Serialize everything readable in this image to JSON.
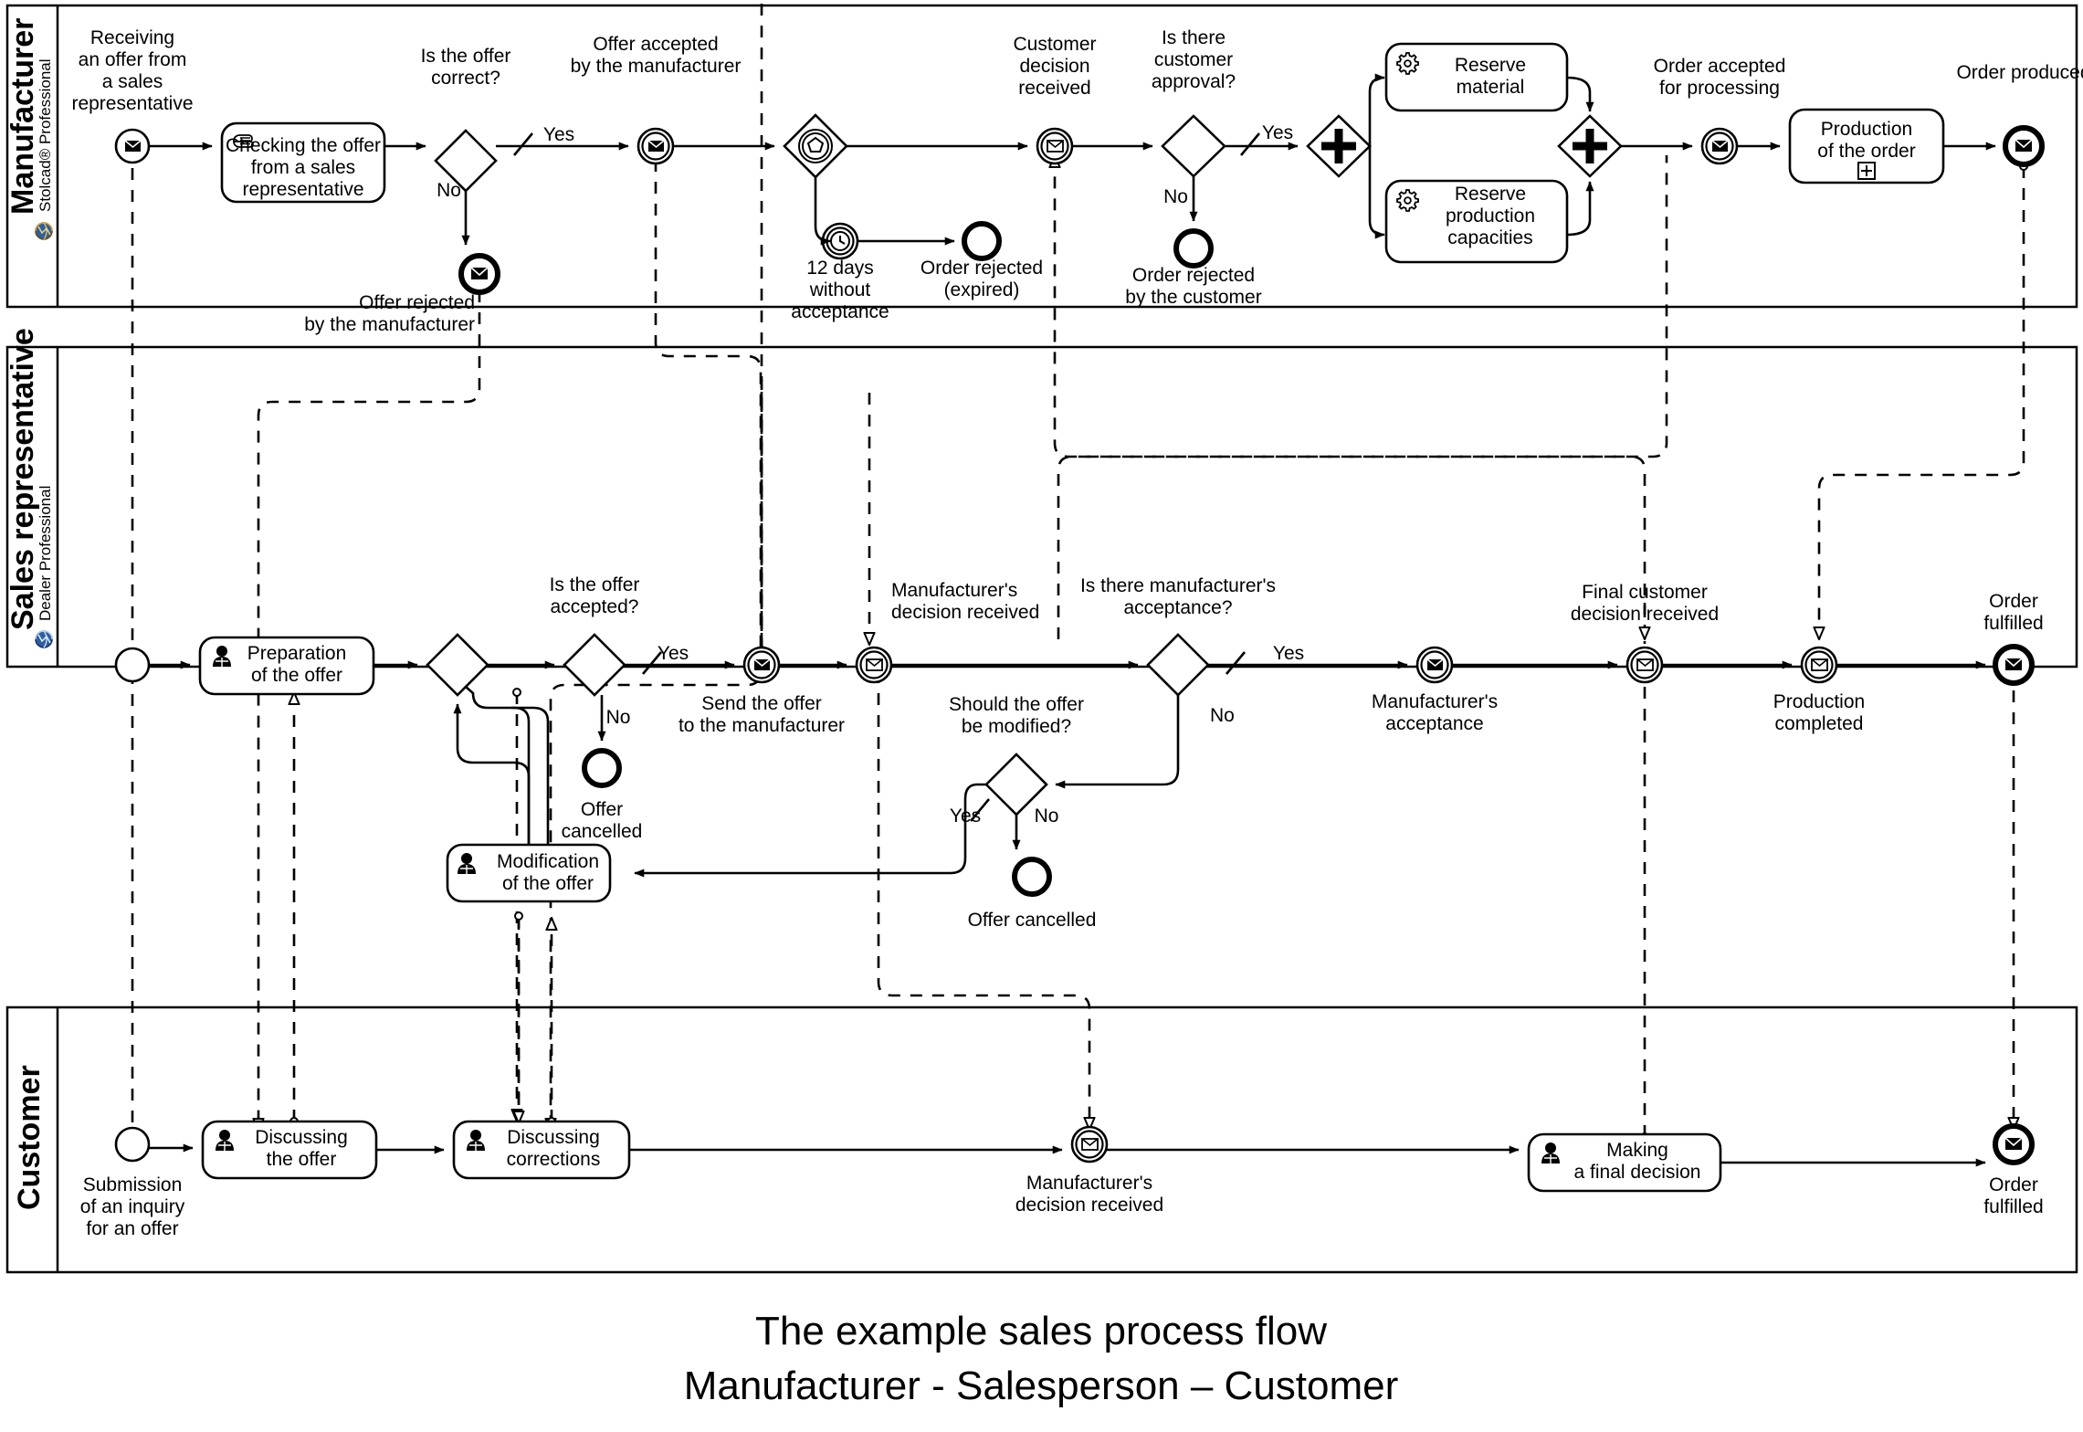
{
  "caption": {
    "line1": "The example sales process flow",
    "line2": "Manufacturer - Salesperson – Customer"
  },
  "lanes": [
    {
      "id": "manufacturer",
      "title": "Manufacturer",
      "subtitle": "Stolcad® Professional",
      "icon": "globe-icon"
    },
    {
      "id": "sales_representative",
      "title": "Sales representative",
      "subtitle": "Dealer Professional",
      "icon": "globe-icon"
    },
    {
      "id": "customer",
      "title": "Customer",
      "subtitle": "",
      "icon": ""
    }
  ],
  "manufacturer_lane": {
    "start_event": {
      "label": "Receiving\nan offer from\na sales\nrepresentative",
      "type": "message-start-event"
    },
    "tasks": [
      {
        "id": "checking_offer",
        "label": "Checking the offer\nfrom a sales\nrepresentative",
        "marker": "manual-task-icon"
      },
      {
        "id": "reserve_material",
        "label": "Reserve\nmaterial",
        "marker": "service-task-icon"
      },
      {
        "id": "reserve_capacities",
        "label": "Reserve\nproduction\ncapacities",
        "marker": "service-task-icon"
      },
      {
        "id": "production_order",
        "label": "Production\nof the order",
        "marker": "subprocess-plus-icon"
      }
    ],
    "gateways": [
      {
        "id": "is_offer_correct",
        "label": "Is the offer\ncorrect?",
        "type": "exclusive-gateway",
        "yes": "Yes",
        "no": "No"
      },
      {
        "id": "event_based",
        "label": "",
        "type": "event-based-gateway"
      },
      {
        "id": "is_customer_approval",
        "label": "Is there\ncustomer\napproval?",
        "type": "exclusive-gateway",
        "yes": "Yes",
        "no": "No"
      },
      {
        "id": "parallel_split",
        "label": "",
        "type": "parallel-gateway"
      },
      {
        "id": "parallel_join",
        "label": "",
        "type": "parallel-gateway"
      }
    ],
    "events": [
      {
        "id": "offer_rejected_manufacturer",
        "label": "Offer rejected\nby the manufacturer",
        "type": "message-end-event"
      },
      {
        "id": "offer_accepted_manufacturer",
        "label": "Offer accepted\nby the manufacturer",
        "type": "message-intermediate-throw-event"
      },
      {
        "id": "twelve_days",
        "label": "12 days\nwithout\nacceptance",
        "type": "timer-intermediate-event"
      },
      {
        "id": "order_rejected_expired",
        "label": "Order rejected\n(expired)",
        "type": "end-event"
      },
      {
        "id": "customer_decision_received",
        "label": "Customer\ndecision\nreceived",
        "type": "message-intermediate-catch-event"
      },
      {
        "id": "order_rejected_customer",
        "label": "Order rejected\nby the customer",
        "type": "end-event"
      },
      {
        "id": "order_accepted_processing",
        "label": "Order accepted\nfor processing",
        "type": "message-intermediate-throw-event"
      },
      {
        "id": "order_produced",
        "label": "Order produced",
        "type": "message-end-event"
      }
    ]
  },
  "sales_lane": {
    "start_event": {
      "label": "",
      "type": "start-event"
    },
    "tasks": [
      {
        "id": "preparation_offer",
        "label": "Preparation\nof the offer",
        "marker": "user-task-icon"
      },
      {
        "id": "modification_offer",
        "label": "Modification\nof the offer",
        "marker": "user-task-icon"
      }
    ],
    "gateways": [
      {
        "id": "merge_gateway",
        "label": "",
        "type": "exclusive-gateway"
      },
      {
        "id": "is_offer_accepted",
        "label": "Is the offer\naccepted?",
        "type": "exclusive-gateway",
        "yes": "Yes",
        "no": "No"
      },
      {
        "id": "is_manufacturer_acceptance",
        "label": "Is there manufacturer's\nacceptance?",
        "type": "exclusive-gateway",
        "yes": "Yes",
        "no": "No"
      },
      {
        "id": "should_offer_be_modified",
        "label": "Should the offer\nbe modified?",
        "type": "exclusive-gateway",
        "yes": "Yes",
        "no": "No"
      }
    ],
    "events": [
      {
        "id": "offer_cancelled_1",
        "label": "Offer\ncancelled",
        "type": "end-event"
      },
      {
        "id": "send_offer_to_manufacturer",
        "label": "Send the offer\nto the manufacturer",
        "type": "message-intermediate-throw-event"
      },
      {
        "id": "manufacturers_decision_received",
        "label": "Manufacturer's\ndecision received",
        "type": "message-intermediate-catch-event"
      },
      {
        "id": "offer_cancelled_2",
        "label": "Offer cancelled",
        "type": "end-event"
      },
      {
        "id": "manufacturers_acceptance",
        "label": "Manufacturer's\nacceptance",
        "type": "message-intermediate-throw-event"
      },
      {
        "id": "final_customer_decision_received",
        "label": "Final customer\ndecision received",
        "type": "message-intermediate-catch-event"
      },
      {
        "id": "production_completed",
        "label": "Production\ncompleted",
        "type": "message-intermediate-catch-event"
      },
      {
        "id": "order_fulfilled_sales",
        "label": "Order\nfulfilled",
        "type": "message-end-event"
      }
    ]
  },
  "customer_lane": {
    "start_event": {
      "label": "Submission\nof an inquiry\nfor an offer",
      "type": "start-event"
    },
    "tasks": [
      {
        "id": "discussing_offer",
        "label": "Discussing\nthe offer",
        "marker": "user-task-icon"
      },
      {
        "id": "discussing_corrections",
        "label": "Discussing\ncorrections",
        "marker": "user-task-icon"
      },
      {
        "id": "making_final_decision",
        "label": "Making\na final decision",
        "marker": "user-task-icon"
      }
    ],
    "events": [
      {
        "id": "manufacturers_decision_received_cust",
        "label": "Manufacturer's\ndecision received",
        "type": "message-intermediate-catch-event"
      },
      {
        "id": "order_fulfilled_customer",
        "label": "Order\nfulfilled",
        "type": "message-end-event"
      }
    ]
  },
  "labels": {
    "yes": "Yes",
    "no": "No"
  },
  "colors": {
    "stroke": "#000000",
    "fill": "#ffffff",
    "globe_icon": "#1f4e9c"
  }
}
